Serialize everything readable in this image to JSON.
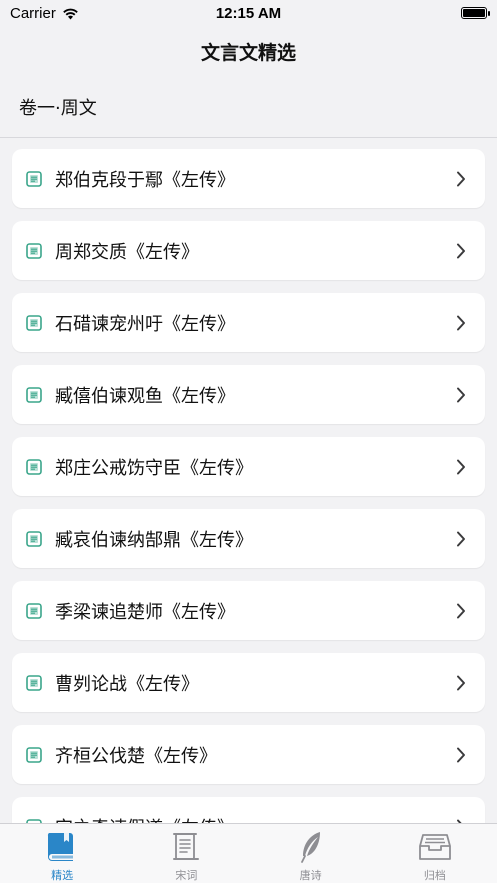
{
  "status_bar": {
    "carrier": "Carrier",
    "time": "12:15 AM"
  },
  "nav": {
    "title": "文言文精选"
  },
  "section": {
    "title": "卷一·周文"
  },
  "items": [
    {
      "label": "郑伯克段于鄢《左传》"
    },
    {
      "label": "周郑交质《左传》"
    },
    {
      "label": "石碏谏宠州吁《左传》"
    },
    {
      "label": "臧僖伯谏观鱼《左传》"
    },
    {
      "label": "郑庄公戒饬守臣《左传》"
    },
    {
      "label": "臧哀伯谏纳郜鼎《左传》"
    },
    {
      "label": "季梁谏追楚师《左传》"
    },
    {
      "label": "曹刿论战《左传》"
    },
    {
      "label": "齐桓公伐楚《左传》"
    },
    {
      "label": "宫之奇谏假道《左传》"
    }
  ],
  "tabs": [
    {
      "label": "精选",
      "icon": "book-icon",
      "active": true
    },
    {
      "label": "宋词",
      "icon": "scroll-icon",
      "active": false
    },
    {
      "label": "唐诗",
      "icon": "feather-icon",
      "active": false
    },
    {
      "label": "归档",
      "icon": "archive-tray-icon",
      "active": false
    }
  ],
  "colors": {
    "accent": "#2a86c8",
    "item_icon": "#3aa58a",
    "inactive": "#8e8e93"
  }
}
